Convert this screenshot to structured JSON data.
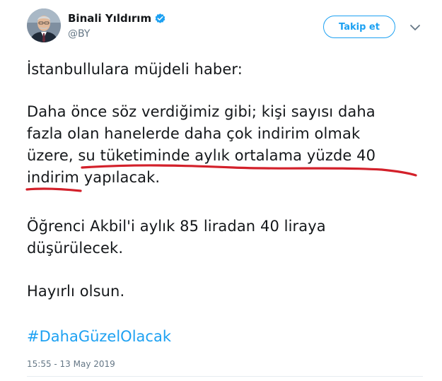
{
  "author": {
    "name": "Binali Yıldırım",
    "handle": "@BY",
    "verified": true
  },
  "follow_button": {
    "label": "Takip et"
  },
  "tweet": {
    "paragraph1": [
      "İstanbullulara müjdeli haber:"
    ],
    "paragraph2": [
      "Daha önce söz verdiğimiz gibi; kişi sayısı daha",
      "fazla olan hanelerde daha çok indirim olmak",
      "üzere, su tüketiminde aylık ortalama yüzde 40",
      "indirim yapılacak."
    ],
    "paragraph3": [
      "Öğrenci Akbil'i aylık 85 liradan 40 liraya",
      "düşürülecek."
    ],
    "paragraph4": [
      "Hayırlı olsun."
    ],
    "hashtag": "#DahaGüzelOlacak",
    "timestamp": "15:55 - 13 May 2019"
  },
  "colors": {
    "accent": "#1da1f2",
    "secondary_text": "#657786",
    "annotation_red": "#d3202a"
  },
  "icons": {
    "verified": "verified-badge-icon",
    "caret": "chevron-down-icon"
  }
}
